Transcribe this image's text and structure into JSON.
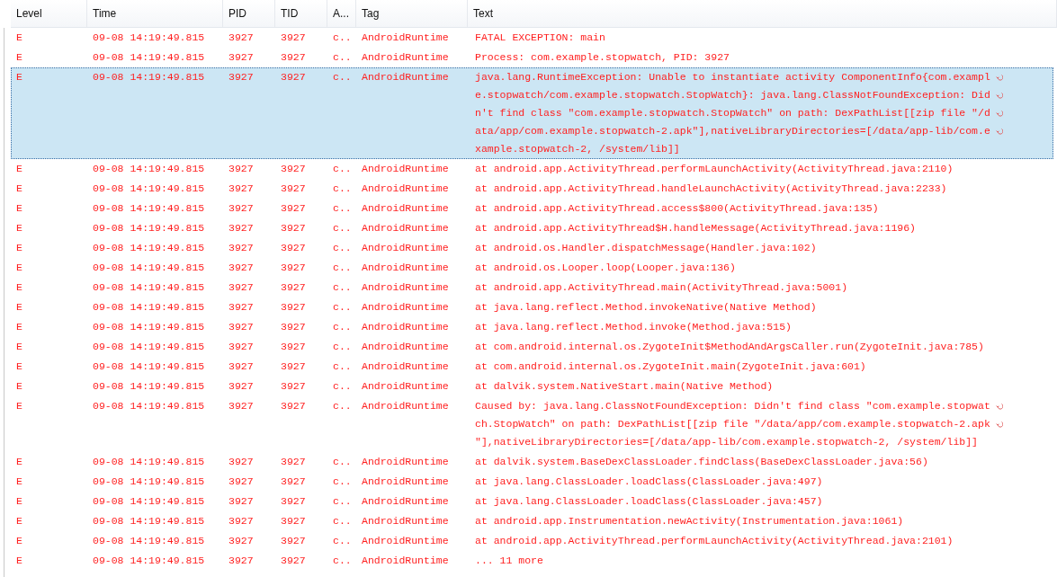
{
  "columns": [
    "Level",
    "Time",
    "PID",
    "TID",
    "A...",
    "Tag",
    "Text"
  ],
  "rows": [
    {
      "level": "E",
      "time": "09-08 14:19:49.815",
      "pid": "3927",
      "tid": "3927",
      "app": "c..",
      "tag": "AndroidRuntime",
      "text": [
        "FATAL EXCEPTION: main"
      ],
      "selected": false
    },
    {
      "level": "E",
      "time": "09-08 14:19:49.815",
      "pid": "3927",
      "tid": "3927",
      "app": "c..",
      "tag": "AndroidRuntime",
      "text": [
        "Process: com.example.stopwatch, PID: 3927"
      ],
      "selected": false
    },
    {
      "level": "E",
      "time": "09-08 14:19:49.815",
      "pid": "3927",
      "tid": "3927",
      "app": "c..",
      "tag": "AndroidRuntime",
      "text": [
        "java.lang.RuntimeException: Unable to instantiate activity ComponentInfo{com.exampl",
        "e.stopwatch/com.example.stopwatch.StopWatch}: java.lang.ClassNotFoundException: Did",
        "n't find class \"com.example.stopwatch.StopWatch\" on path: DexPathList[[zip file \"/d",
        "ata/app/com.example.stopwatch-2.apk\"],nativeLibraryDirectories=[/data/app-lib/com.e",
        "xample.stopwatch-2, /system/lib]]"
      ],
      "selected": true
    },
    {
      "level": "E",
      "time": "09-08 14:19:49.815",
      "pid": "3927",
      "tid": "3927",
      "app": "c..",
      "tag": "AndroidRuntime",
      "text": [
        "at android.app.ActivityThread.performLaunchActivity(ActivityThread.java:2110)"
      ],
      "selected": false
    },
    {
      "level": "E",
      "time": "09-08 14:19:49.815",
      "pid": "3927",
      "tid": "3927",
      "app": "c..",
      "tag": "AndroidRuntime",
      "text": [
        "at android.app.ActivityThread.handleLaunchActivity(ActivityThread.java:2233)"
      ],
      "selected": false
    },
    {
      "level": "E",
      "time": "09-08 14:19:49.815",
      "pid": "3927",
      "tid": "3927",
      "app": "c..",
      "tag": "AndroidRuntime",
      "text": [
        "at android.app.ActivityThread.access$800(ActivityThread.java:135)"
      ],
      "selected": false
    },
    {
      "level": "E",
      "time": "09-08 14:19:49.815",
      "pid": "3927",
      "tid": "3927",
      "app": "c..",
      "tag": "AndroidRuntime",
      "text": [
        "at android.app.ActivityThread$H.handleMessage(ActivityThread.java:1196)"
      ],
      "selected": false
    },
    {
      "level": "E",
      "time": "09-08 14:19:49.815",
      "pid": "3927",
      "tid": "3927",
      "app": "c..",
      "tag": "AndroidRuntime",
      "text": [
        "at android.os.Handler.dispatchMessage(Handler.java:102)"
      ],
      "selected": false
    },
    {
      "level": "E",
      "time": "09-08 14:19:49.815",
      "pid": "3927",
      "tid": "3927",
      "app": "c..",
      "tag": "AndroidRuntime",
      "text": [
        "at android.os.Looper.loop(Looper.java:136)"
      ],
      "selected": false
    },
    {
      "level": "E",
      "time": "09-08 14:19:49.815",
      "pid": "3927",
      "tid": "3927",
      "app": "c..",
      "tag": "AndroidRuntime",
      "text": [
        "at android.app.ActivityThread.main(ActivityThread.java:5001)"
      ],
      "selected": false
    },
    {
      "level": "E",
      "time": "09-08 14:19:49.815",
      "pid": "3927",
      "tid": "3927",
      "app": "c..",
      "tag": "AndroidRuntime",
      "text": [
        "at java.lang.reflect.Method.invokeNative(Native Method)"
      ],
      "selected": false
    },
    {
      "level": "E",
      "time": "09-08 14:19:49.815",
      "pid": "3927",
      "tid": "3927",
      "app": "c..",
      "tag": "AndroidRuntime",
      "text": [
        "at java.lang.reflect.Method.invoke(Method.java:515)"
      ],
      "selected": false
    },
    {
      "level": "E",
      "time": "09-08 14:19:49.815",
      "pid": "3927",
      "tid": "3927",
      "app": "c..",
      "tag": "AndroidRuntime",
      "text": [
        "at com.android.internal.os.ZygoteInit$MethodAndArgsCaller.run(ZygoteInit.java:785)"
      ],
      "selected": false
    },
    {
      "level": "E",
      "time": "09-08 14:19:49.815",
      "pid": "3927",
      "tid": "3927",
      "app": "c..",
      "tag": "AndroidRuntime",
      "text": [
        "at com.android.internal.os.ZygoteInit.main(ZygoteInit.java:601)"
      ],
      "selected": false
    },
    {
      "level": "E",
      "time": "09-08 14:19:49.815",
      "pid": "3927",
      "tid": "3927",
      "app": "c..",
      "tag": "AndroidRuntime",
      "text": [
        "at dalvik.system.NativeStart.main(Native Method)"
      ],
      "selected": false
    },
    {
      "level": "E",
      "time": "09-08 14:19:49.815",
      "pid": "3927",
      "tid": "3927",
      "app": "c..",
      "tag": "AndroidRuntime",
      "text": [
        "Caused by: java.lang.ClassNotFoundException: Didn't find class \"com.example.stopwat",
        "ch.StopWatch\" on path: DexPathList[[zip file \"/data/app/com.example.stopwatch-2.apk",
        "\"],nativeLibraryDirectories=[/data/app-lib/com.example.stopwatch-2, /system/lib]]"
      ],
      "selected": false
    },
    {
      "level": "E",
      "time": "09-08 14:19:49.815",
      "pid": "3927",
      "tid": "3927",
      "app": "c..",
      "tag": "AndroidRuntime",
      "text": [
        "at dalvik.system.BaseDexClassLoader.findClass(BaseDexClassLoader.java:56)"
      ],
      "selected": false
    },
    {
      "level": "E",
      "time": "09-08 14:19:49.815",
      "pid": "3927",
      "tid": "3927",
      "app": "c..",
      "tag": "AndroidRuntime",
      "text": [
        "at java.lang.ClassLoader.loadClass(ClassLoader.java:497)"
      ],
      "selected": false
    },
    {
      "level": "E",
      "time": "09-08 14:19:49.815",
      "pid": "3927",
      "tid": "3927",
      "app": "c..",
      "tag": "AndroidRuntime",
      "text": [
        "at java.lang.ClassLoader.loadClass(ClassLoader.java:457)"
      ],
      "selected": false
    },
    {
      "level": "E",
      "time": "09-08 14:19:49.815",
      "pid": "3927",
      "tid": "3927",
      "app": "c..",
      "tag": "AndroidRuntime",
      "text": [
        "at android.app.Instrumentation.newActivity(Instrumentation.java:1061)"
      ],
      "selected": false
    },
    {
      "level": "E",
      "time": "09-08 14:19:49.815",
      "pid": "3927",
      "tid": "3927",
      "app": "c..",
      "tag": "AndroidRuntime",
      "text": [
        "at android.app.ActivityThread.performLaunchActivity(ActivityThread.java:2101)"
      ],
      "selected": false
    },
    {
      "level": "E",
      "time": "09-08 14:19:49.815",
      "pid": "3927",
      "tid": "3927",
      "app": "c..",
      "tag": "AndroidRuntime",
      "text": [
        "... 11 more"
      ],
      "selected": false
    }
  ]
}
